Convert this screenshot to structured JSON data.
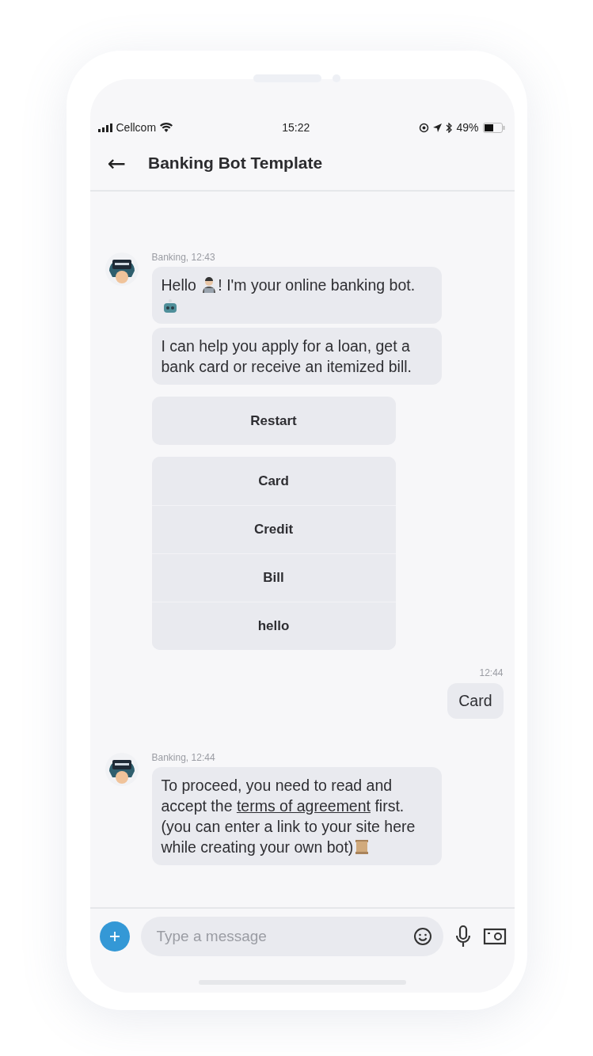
{
  "status_bar": {
    "carrier": "Cellcom",
    "time": "15:22",
    "battery": "49%"
  },
  "header": {
    "back": "←",
    "title": "Banking Bot Template"
  },
  "messages": [
    {
      "kind": "bot",
      "meta": "Banking, 12:43",
      "bubbles": [
        [
          {
            "kind": "text",
            "text": "Hello "
          },
          {
            "kind": "technologist"
          },
          {
            "kind": "text",
            "text": "! I'm your online banking bot."
          },
          {
            "kind": "robot"
          }
        ],
        [
          {
            "kind": "text",
            "text": "I can help you apply for a loan, get a bank card or receive an itemized bill."
          }
        ]
      ],
      "quick_replies": [
        [
          "Restart"
        ],
        [
          "Card",
          "Credit",
          "Bill",
          "hello"
        ]
      ]
    },
    {
      "kind": "user",
      "meta": "12:44",
      "bubbles": [
        [
          {
            "kind": "text",
            "text": "Card"
          }
        ]
      ]
    },
    {
      "kind": "bot",
      "meta": "Banking, 12:44",
      "bubbles": [
        [
          {
            "kind": "text",
            "text": "To proceed, you need to read and accept the "
          },
          {
            "kind": "link",
            "text": "terms of agreement"
          },
          {
            "kind": "text",
            "text": " first. (you can enter a link to your site here while creating your own bot)"
          },
          {
            "kind": "scroll"
          }
        ]
      ]
    }
  ],
  "composer": {
    "placeholder": "Type a message"
  }
}
